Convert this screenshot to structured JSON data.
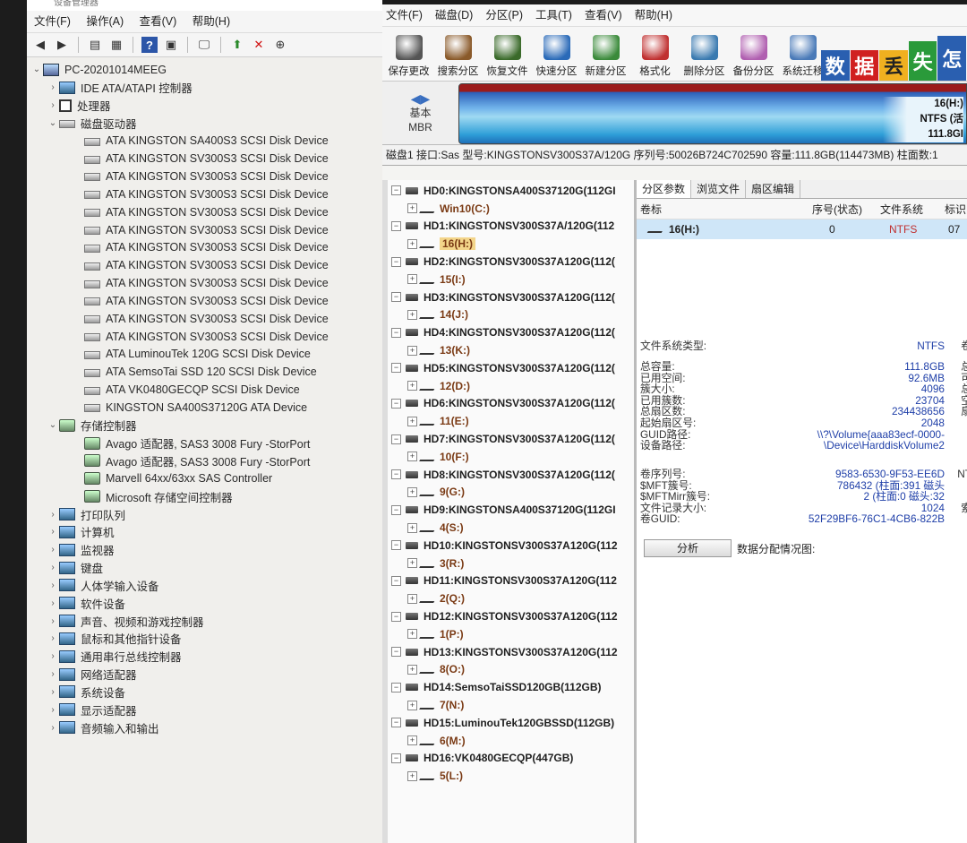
{
  "devmgr": {
    "title": "设备管理器",
    "menu": [
      "文件(F)",
      "操作(A)",
      "查看(V)",
      "帮助(H)"
    ],
    "root": "PC-20201014MEEG",
    "categories": [
      {
        "label": "IDE ATA/ATAPI 控制器",
        "expanded": false,
        "icon": "cat"
      },
      {
        "label": "处理器",
        "expanded": false,
        "icon": "cpu"
      },
      {
        "label": "磁盘驱动器",
        "expanded": true,
        "icon": "disk"
      }
    ],
    "disks": [
      "ATA KINGSTON SA400S3 SCSI Disk Device",
      "ATA KINGSTON SV300S3 SCSI Disk Device",
      "ATA KINGSTON SV300S3 SCSI Disk Device",
      "ATA KINGSTON SV300S3 SCSI Disk Device",
      "ATA KINGSTON SV300S3 SCSI Disk Device",
      "ATA KINGSTON SV300S3 SCSI Disk Device",
      "ATA KINGSTON SV300S3 SCSI Disk Device",
      "ATA KINGSTON SV300S3 SCSI Disk Device",
      "ATA KINGSTON SV300S3 SCSI Disk Device",
      "ATA KINGSTON SV300S3 SCSI Disk Device",
      "ATA KINGSTON SV300S3 SCSI Disk Device",
      "ATA KINGSTON SV300S3 SCSI Disk Device",
      "ATA LuminouTek  120G SCSI Disk Device",
      "ATA SemsoTai SSD 120 SCSI Disk Device",
      "ATA VK0480GECQP SCSI Disk Device",
      "KINGSTON SA400S37120G ATA Device"
    ],
    "storage_label": "存储控制器",
    "storage": [
      "Avago 适配器, SAS3 3008 Fury -StorPort",
      "Avago 适配器, SAS3 3008 Fury -StorPort",
      "Marvell 64xx/63xx SAS Controller",
      "Microsoft 存储空间控制器"
    ],
    "more_categories": [
      "打印队列",
      "计算机",
      "监视器",
      "键盘",
      "人体学输入设备",
      "软件设备",
      "声音、视频和游戏控制器",
      "鼠标和其他指针设备",
      "通用串行总线控制器",
      "网络适配器",
      "系统设备",
      "显示适配器",
      "音频输入和输出"
    ]
  },
  "dg": {
    "menu": [
      "文件(F)",
      "磁盘(D)",
      "分区(P)",
      "工具(T)",
      "查看(V)",
      "帮助(H)"
    ],
    "tools": [
      {
        "label": "保存更改",
        "color": "#555555"
      },
      {
        "label": "搜索分区",
        "color": "#8a5a2a"
      },
      {
        "label": "恢复文件",
        "color": "#3a6a2a"
      },
      {
        "label": "快速分区",
        "color": "#2a6ab8"
      },
      {
        "label": "新建分区",
        "color": "#3a8a3a"
      },
      {
        "label": "格式化",
        "color": "#c03030"
      },
      {
        "label": "删除分区",
        "color": "#3a7ab0"
      },
      {
        "label": "备份分区",
        "color": "#b05fb0"
      },
      {
        "label": "系统迁移",
        "color": "#4a7ab8"
      }
    ],
    "banner": [
      "数",
      "据",
      "丢",
      "失",
      "怎"
    ],
    "map": {
      "type_label": "基本",
      "scheme": "MBR",
      "part_label": "16(H:)",
      "part_fs": "NTFS (活",
      "part_size": "111.8GI"
    },
    "disk_info": "磁盘1 接口:Sas  型号:KINGSTONSV300S37A/120G  序列号:50026B724C702590  容量:111.8GB(114473MB)  柱面数:1",
    "drives": [
      {
        "name": "HD0:KINGSTONSA400S37120G(112GI",
        "part": "Win10(C:)"
      },
      {
        "name": "HD1:KINGSTONSV300S37A/120G(112",
        "part": "16(H:)",
        "selected": true
      },
      {
        "name": "HD2:KINGSTONSV300S37A120G(112(",
        "part": "15(I:)"
      },
      {
        "name": "HD3:KINGSTONSV300S37A120G(112(",
        "part": "14(J:)"
      },
      {
        "name": "HD4:KINGSTONSV300S37A120G(112(",
        "part": "13(K:)"
      },
      {
        "name": "HD5:KINGSTONSV300S37A120G(112(",
        "part": "12(D:)"
      },
      {
        "name": "HD6:KINGSTONSV300S37A120G(112(",
        "part": "11(E:)"
      },
      {
        "name": "HD7:KINGSTONSV300S37A120G(112(",
        "part": "10(F:)"
      },
      {
        "name": "HD8:KINGSTONSV300S37A120G(112(",
        "part": "9(G:)"
      },
      {
        "name": "HD9:KINGSTONSA400S37120G(112GI",
        "part": "4(S:)"
      },
      {
        "name": "HD10:KINGSTONSV300S37A120G(112",
        "part": "3(R:)"
      },
      {
        "name": "HD11:KINGSTONSV300S37A120G(112",
        "part": "2(Q:)"
      },
      {
        "name": "HD12:KINGSTONSV300S37A120G(112",
        "part": "1(P:)"
      },
      {
        "name": "HD13:KINGSTONSV300S37A120G(112",
        "part": "8(O:)"
      },
      {
        "name": "HD14:SemsoTaiSSD120GB(112GB)",
        "part": "7(N:)"
      },
      {
        "name": "HD15:LuminouTek120GBSSD(112GB)",
        "part": "6(M:)"
      },
      {
        "name": "HD16:VK0480GECQP(447GB)",
        "part": "5(L:)"
      }
    ],
    "tabs": [
      "分区参数",
      "浏览文件",
      "扇区编辑"
    ],
    "columns": [
      "卷标",
      "序号(状态)",
      "文件系统",
      "标识"
    ],
    "row": {
      "label": "16(H:)",
      "index": "0",
      "fs": "NTFS",
      "id": "07"
    },
    "fs_type_label": "文件系统类型:",
    "fs_type_value": "NTFS",
    "fs_type_extra": "卷",
    "details": [
      {
        "k": "总容量:",
        "v": "111.8GB",
        "x": "总"
      },
      {
        "k": "已用空间:",
        "v": "92.6MB",
        "x": "可"
      },
      {
        "k": "簇大小:",
        "v": "4096",
        "x": "总"
      },
      {
        "k": "已用簇数:",
        "v": "23704",
        "x": "空"
      },
      {
        "k": "总扇区数:",
        "v": "234438656",
        "x": "扇"
      },
      {
        "k": "起始扇区号:",
        "v": "2048",
        "x": ""
      },
      {
        "k": "GUID路径:",
        "v": "\\\\?\\Volume{aaa83ecf-0000-",
        "x": ""
      },
      {
        "k": "设备路径:",
        "v": "\\Device\\HarddiskVolume2",
        "x": ""
      }
    ],
    "details2": [
      {
        "k": "卷序列号:",
        "v": "9583-6530-9F53-EE6D",
        "x": "NT"
      },
      {
        "k": "$MFT簇号:",
        "v": "786432 (柱面:391 磁头",
        "x": ""
      },
      {
        "k": "$MFTMirr簇号:",
        "v": "2 (柱面:0 磁头:32",
        "x": ""
      },
      {
        "k": "文件记录大小:",
        "v": "1024",
        "x": "索"
      },
      {
        "k": "卷GUID:",
        "v": "52F29BF6-76C1-4CB6-822B",
        "x": ""
      }
    ],
    "analyze_button": "分析",
    "alloc_label": "数据分配情况图:"
  }
}
